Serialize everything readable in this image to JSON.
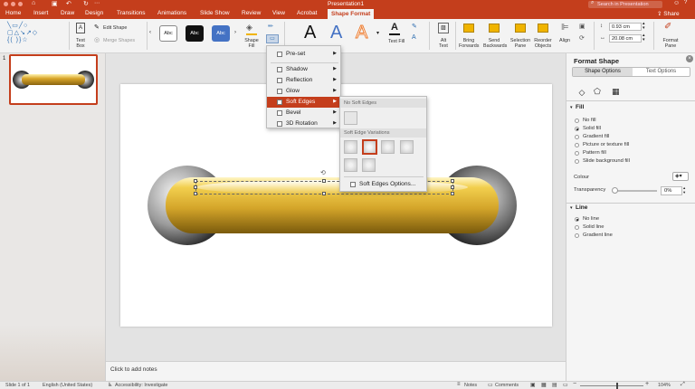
{
  "window": {
    "title": "Presentation1",
    "search_placeholder": "Search in Presentation",
    "share_label": "Share"
  },
  "tabs": [
    "Home",
    "Insert",
    "Draw",
    "Design",
    "Transitions",
    "Animations",
    "Slide Show",
    "Review",
    "View",
    "Acrobat",
    "Shape Format"
  ],
  "active_tab": "Shape Format",
  "ribbon": {
    "text_box": "Text Box",
    "edit_shape": "Edit Shape",
    "merge_shapes": "Merge Shapes",
    "style_labels": [
      "Abc",
      "Abc",
      "Abc"
    ],
    "shape_fill": "Shape Fill",
    "wordart_letter": "A",
    "text_fill": "Text Fill",
    "alt_text": "Alt Text",
    "bring_forwards": "Bring Forwards",
    "send_backwards": "Send Backwards",
    "selection_pane": "Selection Pane",
    "reorder_objects": "Reorder Objects",
    "align": "Align",
    "height_value": "0.93 cm",
    "width_value": "20.08 cm",
    "format_pane": "Format Pane"
  },
  "effects_menu": {
    "items": [
      {
        "label": "Pre-set",
        "selected": false
      },
      {
        "label": "Shadow",
        "selected": false
      },
      {
        "label": "Reflection",
        "selected": false
      },
      {
        "label": "Glow",
        "selected": false
      },
      {
        "label": "Soft Edges",
        "selected": true
      },
      {
        "label": "Bevel",
        "selected": false
      },
      {
        "label": "3D Rotation",
        "selected": false
      }
    ]
  },
  "soft_edges_submenu": {
    "no_soft_edges": "No Soft Edges",
    "variations_header": "Soft Edge Variations",
    "options_label": "Soft Edges Options..."
  },
  "thumbnail": {
    "number": "1"
  },
  "notes": {
    "placeholder": "Click to add notes"
  },
  "format_pane": {
    "title": "Format Shape",
    "tabs": [
      "Shape Options",
      "Text Options"
    ],
    "active_tab": "Shape Options",
    "fill_header": "Fill",
    "fill_options": [
      {
        "label": "No fill",
        "checked": false
      },
      {
        "label": "Solid fill",
        "checked": true
      },
      {
        "label": "Gradient fill",
        "checked": false
      },
      {
        "label": "Picture or texture fill",
        "checked": false
      },
      {
        "label": "Pattern fill",
        "checked": false
      },
      {
        "label": "Slide background fill",
        "checked": false
      }
    ],
    "colour_label": "Colour",
    "transparency_label": "Transparency",
    "transparency_value": "0%",
    "line_header": "Line",
    "line_options": [
      {
        "label": "No line",
        "checked": true
      },
      {
        "label": "Solid line",
        "checked": false
      },
      {
        "label": "Gradient line",
        "checked": false
      }
    ]
  },
  "status": {
    "slide": "Slide 1 of 1",
    "language": "English (United States)",
    "accessibility": "Accessibility: Investigate",
    "notes": "Notes",
    "comments": "Comments",
    "zoom": "104%"
  },
  "colors": {
    "accent": "#c43e1c",
    "gold": "#d4a52a"
  }
}
